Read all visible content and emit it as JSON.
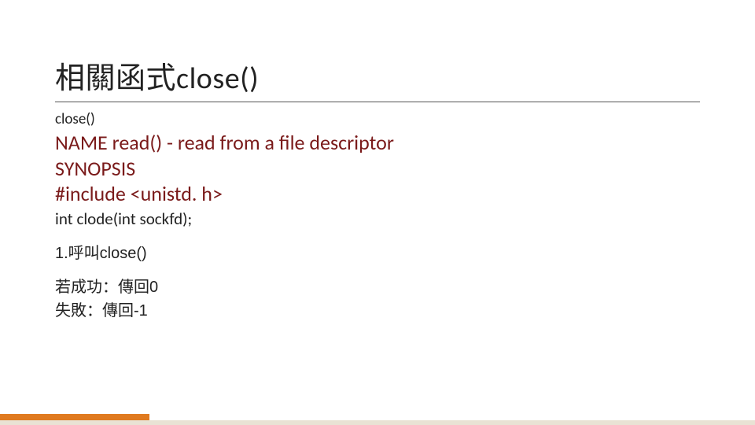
{
  "title": {
    "cjk": "相關函式",
    "latin": "close()"
  },
  "subtitle": "close()",
  "man": {
    "line1": "NAME read() - read from a file descriptor",
    "line2": "SYNOPSIS",
    "line3": "#include <unistd. h>"
  },
  "prototype": "int clode(int sockfd);",
  "note": "1.呼叫close()",
  "results": {
    "success": "若成功：傳回0",
    "failure": "失敗：傳回-1"
  }
}
